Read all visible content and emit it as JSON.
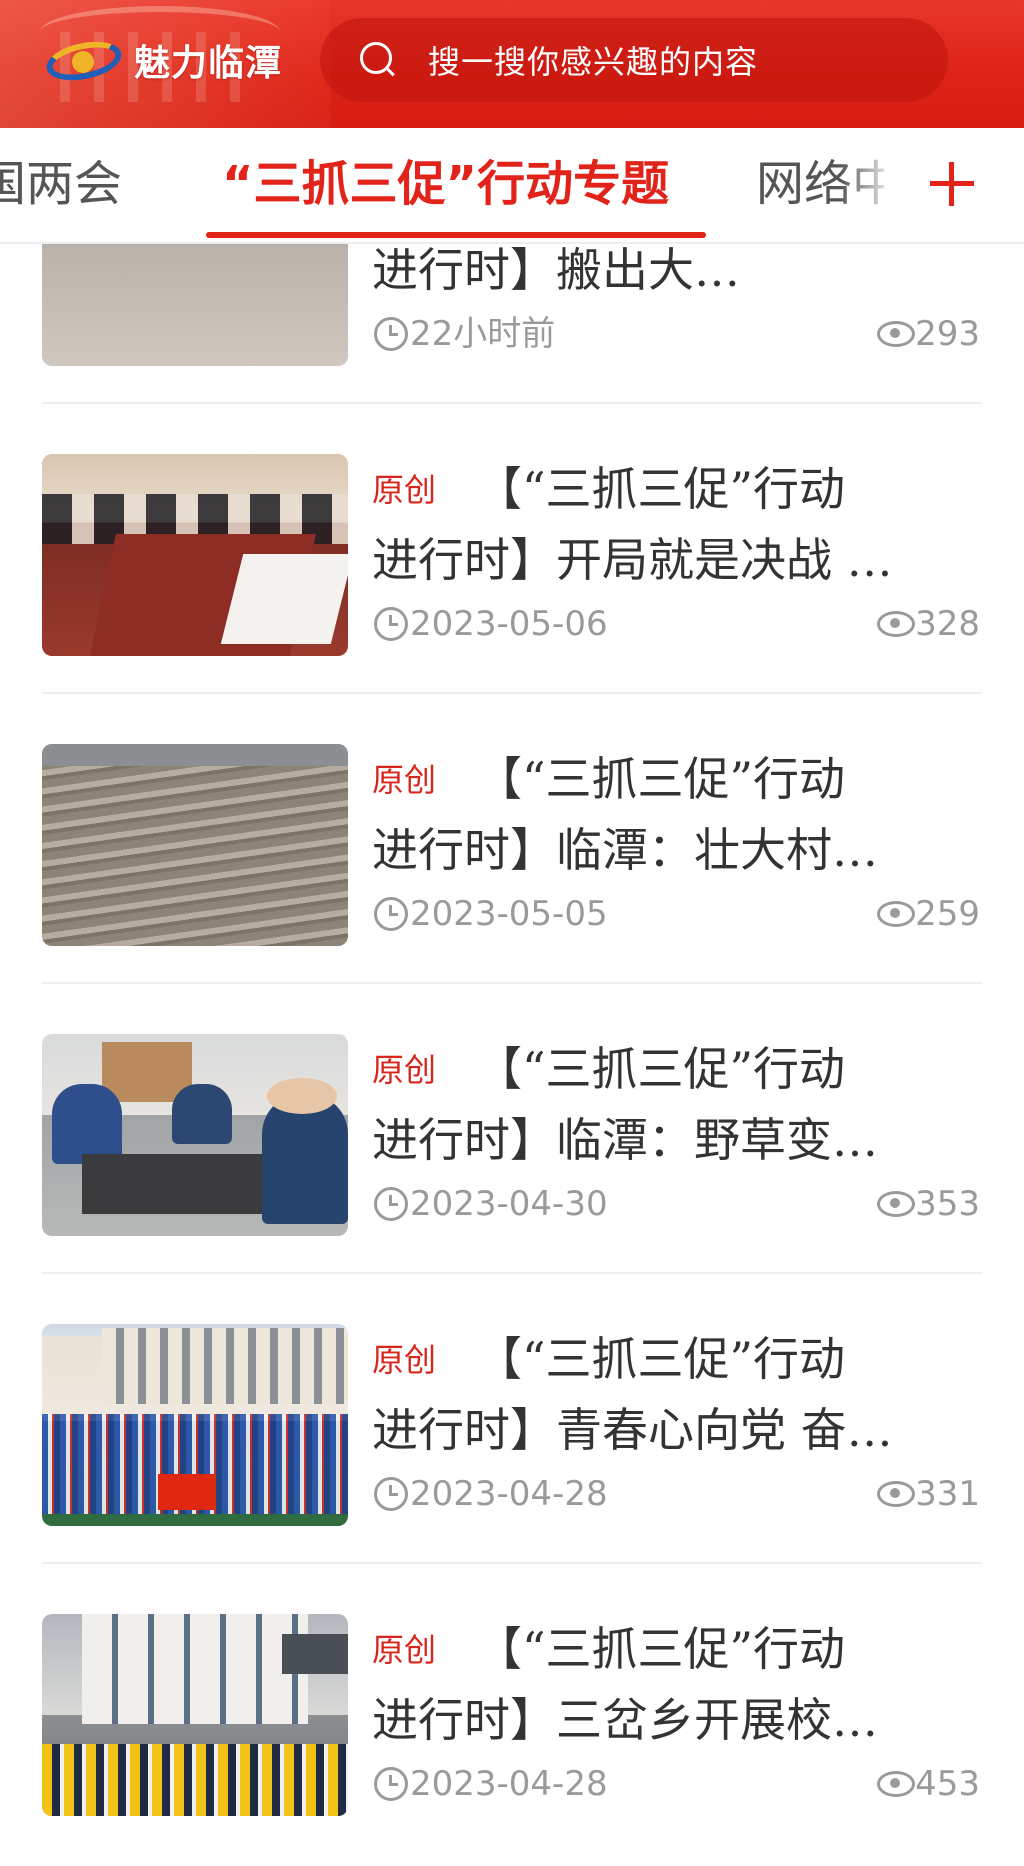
{
  "header": {
    "app_title": "魅力临潭",
    "search_placeholder": "搜一搜你感兴趣的内容"
  },
  "tabs": {
    "prev_label": "国两会",
    "active_label": "“三抓三促”行动专题",
    "next_label": "网络中"
  },
  "colors": {
    "brand_red": "#e2231a",
    "meta_gray": "#9a9a9a"
  },
  "news": [
    {
      "tag": "",
      "line1": "",
      "line2": "进行时】搬出大…",
      "time": "22小时前",
      "views": "293",
      "image": "street-scene"
    },
    {
      "tag": "原创",
      "line1": "【“三抓三促”行动",
      "line2": "进行时】开局就是决战 …",
      "time": "2023-05-06",
      "views": "328",
      "image": "meeting-room"
    },
    {
      "tag": "原创",
      "line1": "【“三抓三促”行动",
      "line2": "进行时】临潭：壮大村…",
      "time": "2023-05-05",
      "views": "259",
      "image": "terraced-fields"
    },
    {
      "tag": "原创",
      "line1": "【“三抓三促”行动",
      "line2": "进行时】临潭：野草变…",
      "time": "2023-04-30",
      "views": "353",
      "image": "workshop"
    },
    {
      "tag": "原创",
      "line1": "【“三抓三促”行动",
      "line2": "进行时】青春心向党 奋…",
      "time": "2023-04-28",
      "views": "331",
      "image": "school-ceremony"
    },
    {
      "tag": "原创",
      "line1": "【“三抓三促”行动",
      "line2": "进行时】三岔乡开展校…",
      "time": "2023-04-28",
      "views": "453",
      "image": "students-assembly"
    }
  ]
}
